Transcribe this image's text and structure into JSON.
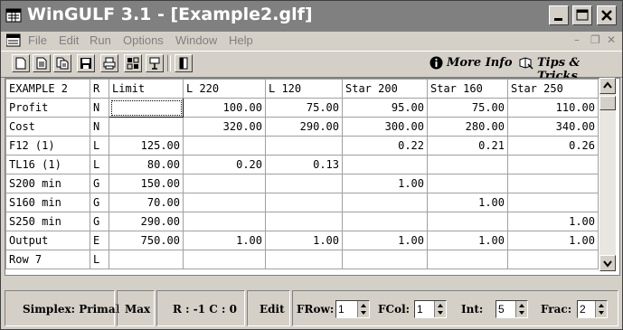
{
  "title": "WinGULF 3.1 - [Example2.glf]",
  "menu": [
    "File",
    "Edit",
    "Run",
    "Options",
    "Window",
    "Help"
  ],
  "links": {
    "more_info": "More Info",
    "tips": "Tips & Tricks"
  },
  "grid": {
    "headers": [
      "EXAMPLE 2",
      "R",
      "Limit",
      "L 220",
      "L 120",
      "Star 200",
      "Star 160",
      "Star 250"
    ],
    "rows": [
      [
        "Profit",
        "N",
        "",
        "100.00",
        "75.00",
        "95.00",
        "75.00",
        "110.00"
      ],
      [
        "Cost",
        "N",
        "",
        "320.00",
        "290.00",
        "300.00",
        "280.00",
        "340.00"
      ],
      [
        "F12 (1)",
        "L",
        "125.00",
        "",
        "",
        "0.22",
        "0.21",
        "0.26"
      ],
      [
        "TL16 (1)",
        "L",
        "80.00",
        "0.20",
        "0.13",
        "",
        "",
        ""
      ],
      [
        "S200 min",
        "G",
        "150.00",
        "",
        "",
        "1.00",
        "",
        ""
      ],
      [
        "S160 min",
        "G",
        "70.00",
        "",
        "",
        "",
        "1.00",
        ""
      ],
      [
        "S250 min",
        "G",
        "290.00",
        "",
        "",
        "",
        "",
        "1.00"
      ],
      [
        "Output",
        "E",
        "750.00",
        "1.00",
        "1.00",
        "1.00",
        "1.00",
        "1.00"
      ],
      [
        "Row  7",
        "L",
        "",
        "",
        "",
        "",
        "",
        ""
      ]
    ]
  },
  "status": {
    "mode": "Simplex: Primal",
    "objective": "Max",
    "rc": "R : -1  C : 0",
    "edit": "Edit",
    "frow_label": "FRow:",
    "frow_value": "1",
    "fcol_label": "FCol:",
    "fcol_value": "1",
    "int_label": "Int:",
    "int_value": "5",
    "frac_label": "Frac:",
    "frac_value": "2"
  }
}
